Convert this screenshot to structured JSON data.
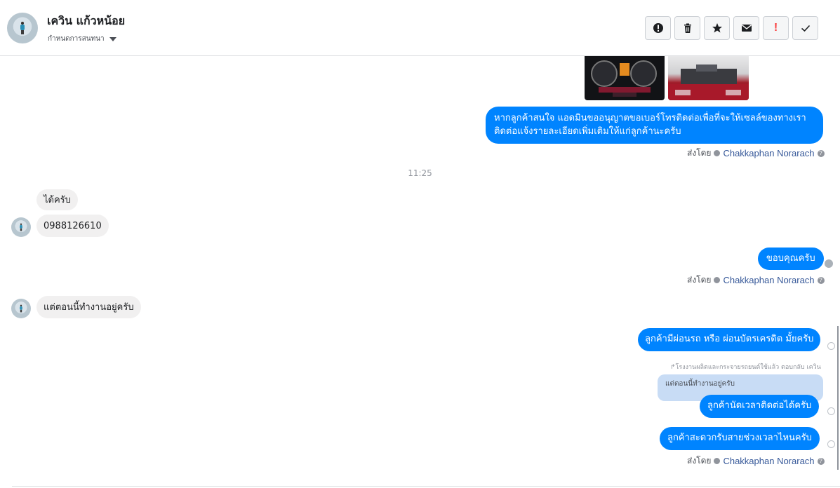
{
  "header": {
    "name": "เควิน แก้วหน้อย",
    "status_label": "กำหนดการสนทนา",
    "actions": [
      {
        "icon": "alert-circle-icon"
      },
      {
        "icon": "trash-icon"
      },
      {
        "icon": "star-icon"
      },
      {
        "icon": "envelope-icon"
      },
      {
        "label": "!",
        "icon": "exclamation-icon"
      },
      {
        "icon": "checkmark-icon"
      }
    ]
  },
  "thread": {
    "images": [
      {
        "icon": "car-dashboard-photo"
      },
      {
        "icon": "car-engine-photo"
      }
    ],
    "msg1_line1": "หากลูกค้าสนใจ แอดมินขออนุญาตขอเบอร์โทรติดต่อเพื่อที่จะให้เซลล์ของทางเรา",
    "msg1_line2": "ติดต่อแจ้งรายละเอียดเพิ่มเติมให้แก่ลูกค้านะครับ",
    "sent_by_prefix": "ส่งโดย",
    "agent_name": "Chakkaphan Norarach",
    "help_mark": "?",
    "time": "11:25",
    "in1": "ได้ครับ",
    "in2": "0988126610",
    "out2": "ขอบคุณครับ",
    "in3": "แต่ตอนนี้ทำงานอยู่ครับ",
    "out3": "ลูกค้ามีผ่อนรถ หรือ ผ่อนบัตรเครดิต มั้ยครับ",
    "reply_note": "↱โรงงานผลิตและกระจายรถยนต์ใช้แล้ว ตอบกลับ เควิน",
    "quoted": "แต่ตอนนี้ทำงานอยู่ครับ",
    "out4": "ลูกค้านัดเวลาติดต่อได้ครับ",
    "out5": "ลูกค้าสะดวกรับสายช่วงเวลาไหนครับ"
  },
  "colors": {
    "outgoing_bubble": "#0084ff",
    "incoming_bubble": "#f1f0f0",
    "agent_link": "#365899",
    "quote_bg": "#c8dcf5"
  }
}
